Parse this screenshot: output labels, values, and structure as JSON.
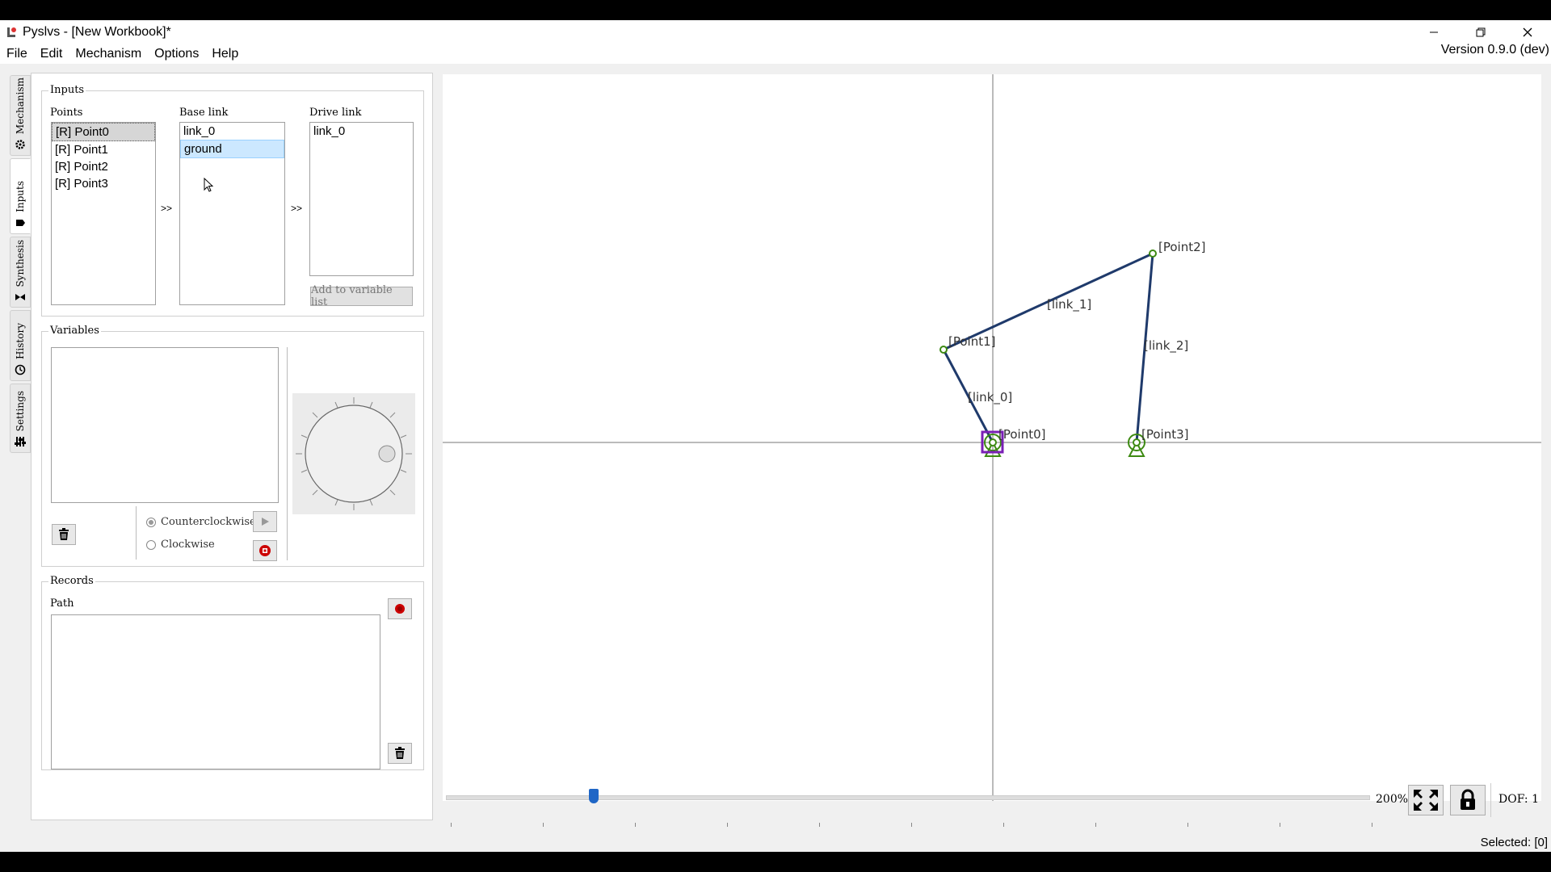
{
  "window": {
    "title": "Pyslvs - [New Workbook]*",
    "version": "Version 0.9.0 (dev)"
  },
  "menu": [
    "File",
    "Edit",
    "Mechanism",
    "Options",
    "Help"
  ],
  "side_tabs": [
    {
      "label": "Mechanism",
      "icon": "gear-icon"
    },
    {
      "label": "Inputs",
      "icon": "tag-icon"
    },
    {
      "label": "Synthesis",
      "icon": "bowtie-icon"
    },
    {
      "label": "History",
      "icon": "clock-icon"
    },
    {
      "label": "Settings",
      "icon": "sliders-icon"
    }
  ],
  "inputs": {
    "group_title": "Inputs",
    "points_label": "Points",
    "points": [
      "[R] Point0",
      "[R] Point1",
      "[R] Point2",
      "[R] Point3"
    ],
    "base_link_label": "Base link",
    "base_links": [
      "link_0",
      "ground"
    ],
    "drive_link_label": "Drive link",
    "drive_links": [
      "link_0"
    ],
    "arrow1": ">>",
    "arrow2": ">>",
    "add_button": "Add to variable list"
  },
  "variables": {
    "group_title": "Variables",
    "counterclockwise": "Counterclockwise",
    "clockwise": "Clockwise"
  },
  "records": {
    "group_title": "Records",
    "path_label": "Path"
  },
  "canvas": {
    "points": [
      {
        "name": "[Point0]"
      },
      {
        "name": "[Point1]"
      },
      {
        "name": "[Point2]"
      },
      {
        "name": "[Point3]"
      }
    ],
    "links": [
      {
        "name": "[link_0]"
      },
      {
        "name": "[link_1]"
      },
      {
        "name": "[link_2]"
      }
    ],
    "link_color": "#1f3a6b",
    "ground_color": "#3d8a12",
    "selection_color": "#7a1fb5"
  },
  "bottom": {
    "zoom": "200%",
    "zoom_fraction": 0.16,
    "dof": "DOF: 1",
    "selected": "Selected: [0]"
  }
}
